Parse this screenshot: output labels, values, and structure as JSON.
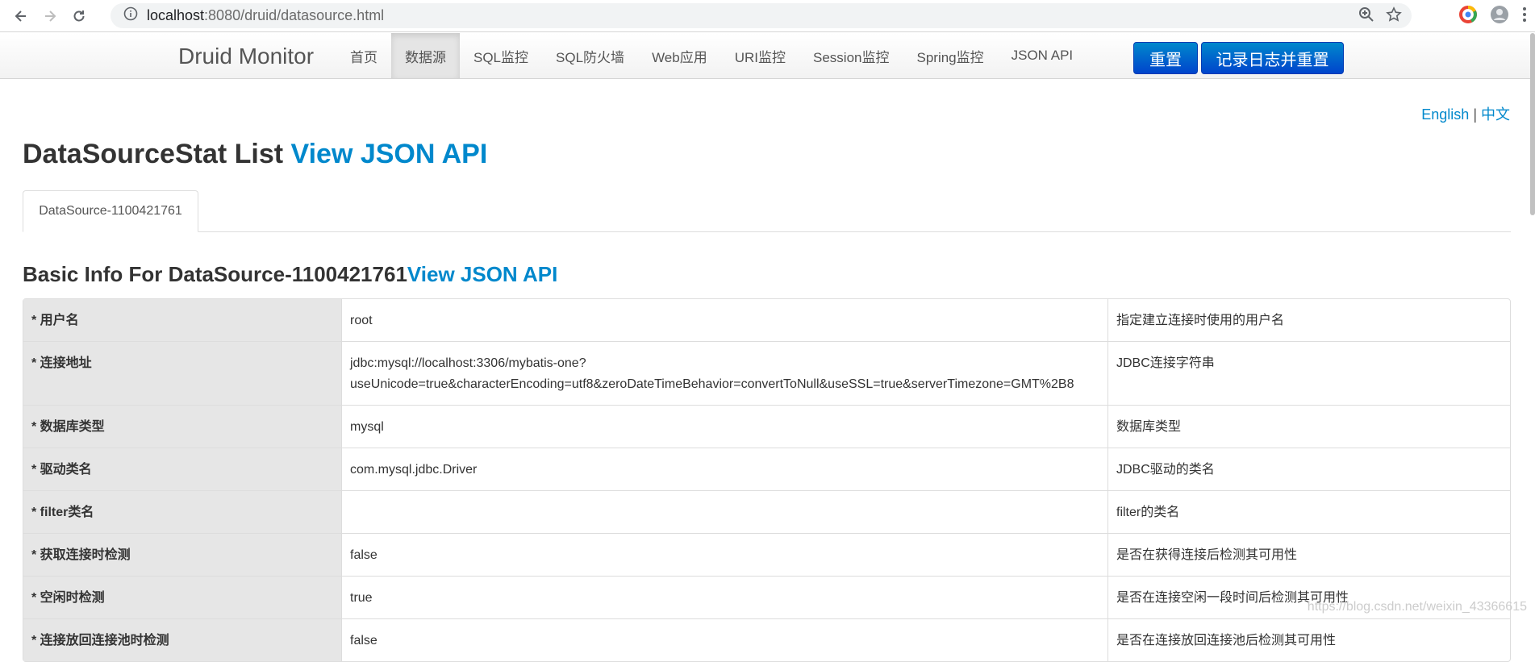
{
  "browser": {
    "url_host": "localhost",
    "url_rest": ":8080/druid/datasource.html"
  },
  "navbar": {
    "brand": "Druid Monitor",
    "items": [
      {
        "label": "首页",
        "active": false
      },
      {
        "label": "数据源",
        "active": true
      },
      {
        "label": "SQL监控",
        "active": false
      },
      {
        "label": "SQL防火墙",
        "active": false
      },
      {
        "label": "Web应用",
        "active": false
      },
      {
        "label": "URI监控",
        "active": false
      },
      {
        "label": "Session监控",
        "active": false
      },
      {
        "label": "Spring监控",
        "active": false
      },
      {
        "label": "JSON API",
        "active": false
      }
    ],
    "reset_label": "重置",
    "log_reset_label": "记录日志并重置"
  },
  "lang": {
    "english": "English",
    "separator": " | ",
    "chinese": "中文"
  },
  "page": {
    "title": "DataSourceStat List ",
    "title_link": "View JSON API",
    "tab": "DataSource-1100421761",
    "subtitle": "Basic Info For DataSource-1100421761",
    "subtitle_link": "View JSON API"
  },
  "rows": [
    {
      "key": "* 用户名",
      "value": "root",
      "value2": "",
      "desc": "指定建立连接时使用的用户名"
    },
    {
      "key": "* 连接地址",
      "value": "jdbc:mysql://localhost:3306/mybatis-one?",
      "value2": "useUnicode=true&characterEncoding=utf8&zeroDateTimeBehavior=convertToNull&useSSL=true&serverTimezone=GMT%2B8",
      "desc": "JDBC连接字符串"
    },
    {
      "key": "* 数据库类型",
      "value": "mysql",
      "value2": "",
      "desc": "数据库类型"
    },
    {
      "key": "* 驱动类名",
      "value": "com.mysql.jdbc.Driver",
      "value2": "",
      "desc": "JDBC驱动的类名"
    },
    {
      "key": "* filter类名",
      "value": "",
      "value2": "",
      "desc": "filter的类名"
    },
    {
      "key": "* 获取连接时检测",
      "value": "false",
      "value2": "",
      "desc": "是否在获得连接后检测其可用性"
    },
    {
      "key": "* 空闲时检测",
      "value": "true",
      "value2": "",
      "desc": "是否在连接空闲一段时间后检测其可用性"
    },
    {
      "key": "* 连接放回连接池时检测",
      "value": "false",
      "value2": "",
      "desc": "是否在连接放回连接池后检测其可用性"
    }
  ],
  "watermark": "https://blog.csdn.net/weixin_43366615"
}
